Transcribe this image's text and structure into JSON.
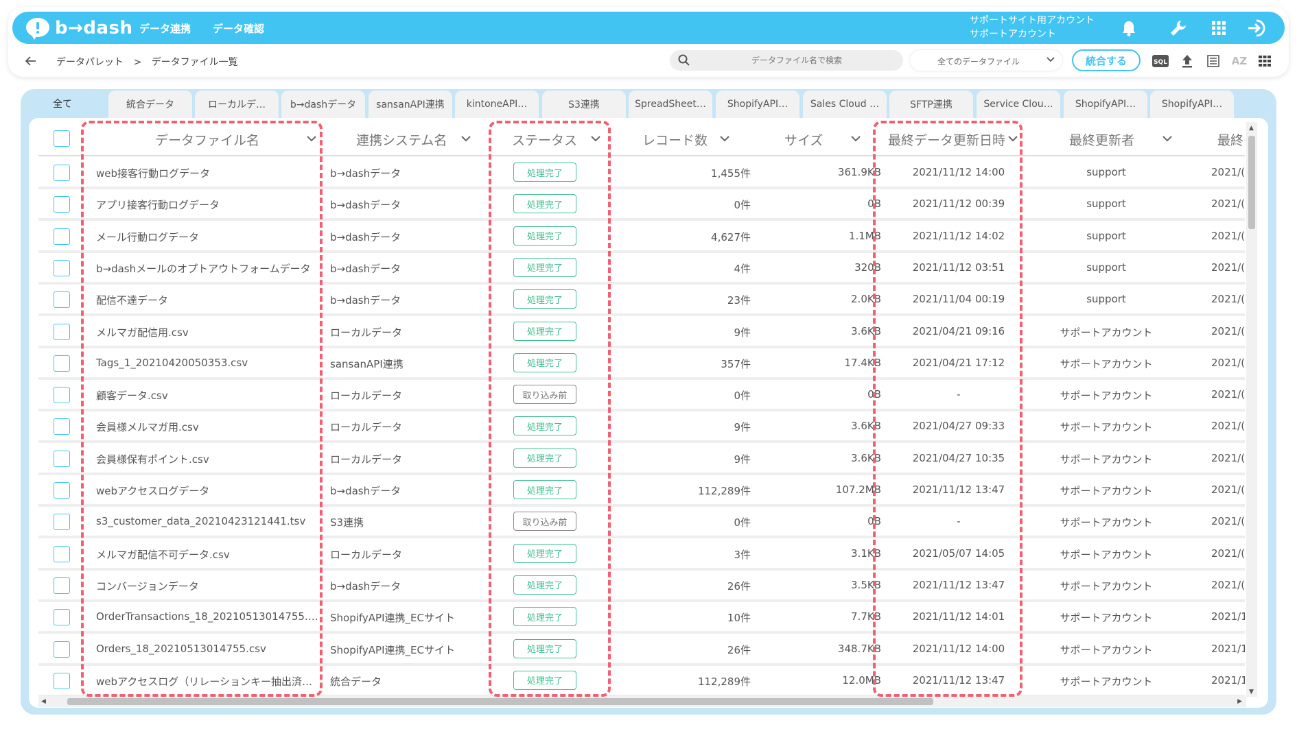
{
  "app": {
    "logo_text": "b→dash",
    "nav": [
      "データ連携",
      "データ確認"
    ],
    "account_line1": "サポートサイト用アカウント",
    "account_line2": "サポートアカウント"
  },
  "breadcrumb": {
    "parent": "データパレット",
    "separator": ">",
    "current": "データファイル一覧"
  },
  "search": {
    "placeholder": "データファイル名で検索"
  },
  "file_filter": {
    "selected": "全てのデータファイル"
  },
  "merge_button": "統合する",
  "toolbar": {
    "sql": "SQL",
    "az": "AZ"
  },
  "tabs": [
    "全て",
    "統合データ",
    "ローカルデ…",
    "b→dashデータ",
    "sansanAPI連携",
    "kintoneAPI…",
    "S3連携",
    "SpreadSheet…",
    "ShopifyAPI…",
    "Sales Cloud …",
    "SFTP連携",
    "Service Clou…",
    "ShopifyAPI…",
    "ShopifyAPI…"
  ],
  "table": {
    "columns": [
      "データファイル名",
      "連携システム名",
      "ステータス",
      "レコード数",
      "サイズ",
      "最終データ更新日時",
      "最終更新者",
      "最終"
    ],
    "rows": [
      {
        "name": "web接客行動ログデータ",
        "system": "b→dashデータ",
        "status": "処理完了",
        "records": "1,455件",
        "size": "361.9KB",
        "updated": "2021/11/12 14:00",
        "user": "support",
        "last": "2021/("
      },
      {
        "name": "アプリ接客行動ログデータ",
        "system": "b→dashデータ",
        "status": "処理完了",
        "records": "0件",
        "size": "0B",
        "updated": "2021/11/12 00:39",
        "user": "support",
        "last": "2021/("
      },
      {
        "name": "メール行動ログデータ",
        "system": "b→dashデータ",
        "status": "処理完了",
        "records": "4,627件",
        "size": "1.1MB",
        "updated": "2021/11/12 14:02",
        "user": "support",
        "last": "2021/("
      },
      {
        "name": "b→dashメールのオプトアウトフォームデータ",
        "system": "b→dashデータ",
        "status": "処理完了",
        "records": "4件",
        "size": "320B",
        "updated": "2021/11/12 03:51",
        "user": "support",
        "last": "2021/("
      },
      {
        "name": "配信不達データ",
        "system": "b→dashデータ",
        "status": "処理完了",
        "records": "23件",
        "size": "2.0KB",
        "updated": "2021/11/04 00:19",
        "user": "support",
        "last": "2021/("
      },
      {
        "name": "メルマガ配信用.csv",
        "system": "ローカルデータ",
        "status": "処理完了",
        "records": "9件",
        "size": "3.6KB",
        "updated": "2021/04/21 09:16",
        "user": "サポートアカウント",
        "last": "2021/("
      },
      {
        "name": "Tags_1_20210420050353.csv",
        "system": "sansanAPI連携",
        "status": "処理完了",
        "records": "357件",
        "size": "17.4KB",
        "updated": "2021/04/21 17:12",
        "user": "サポートアカウント",
        "last": "2021/("
      },
      {
        "name": "顧客データ.csv",
        "system": "ローカルデータ",
        "status": "取り込み前",
        "records": "0件",
        "size": "0B",
        "updated": "-",
        "user": "サポートアカウント",
        "last": "2021/("
      },
      {
        "name": "会員様メルマガ用.csv",
        "system": "ローカルデータ",
        "status": "処理完了",
        "records": "9件",
        "size": "3.6KB",
        "updated": "2021/04/27 09:33",
        "user": "サポートアカウント",
        "last": "2021/("
      },
      {
        "name": "会員様保有ポイント.csv",
        "system": "ローカルデータ",
        "status": "処理完了",
        "records": "9件",
        "size": "3.6KB",
        "updated": "2021/04/27 10:35",
        "user": "サポートアカウント",
        "last": "2021/("
      },
      {
        "name": "webアクセスログデータ",
        "system": "b→dashデータ",
        "status": "処理完了",
        "records": "112,289件",
        "size": "107.2MB",
        "updated": "2021/11/12 13:47",
        "user": "サポートアカウント",
        "last": "2021/("
      },
      {
        "name": "s3_customer_data_20210423121441.tsv",
        "system": "S3連携",
        "status": "取り込み前",
        "records": "0件",
        "size": "0B",
        "updated": "-",
        "user": "サポートアカウント",
        "last": "2021/("
      },
      {
        "name": "メルマガ配信不可データ.csv",
        "system": "ローカルデータ",
        "status": "処理完了",
        "records": "3件",
        "size": "3.1KB",
        "updated": "2021/05/07 14:05",
        "user": "サポートアカウント",
        "last": "2021/("
      },
      {
        "name": "コンバージョンデータ",
        "system": "b→dashデータ",
        "status": "処理完了",
        "records": "26件",
        "size": "3.5KB",
        "updated": "2021/11/12 13:47",
        "user": "サポートアカウント",
        "last": "2021/("
      },
      {
        "name": "OrderTransactions_18_20210513014755.…",
        "system": "ShopifyAPI連携_ECサイト",
        "status": "処理完了",
        "records": "10件",
        "size": "7.7KB",
        "updated": "2021/11/12 14:01",
        "user": "サポートアカウント",
        "last": "2021/1"
      },
      {
        "name": "Orders_18_20210513014755.csv",
        "system": "ShopifyAPI連携_ECサイト",
        "status": "処理完了",
        "records": "26件",
        "size": "348.7KB",
        "updated": "2021/11/12 14:00",
        "user": "サポートアカウント",
        "last": "2021/1"
      },
      {
        "name": "webアクセスログ（リレーションキー抽出済…",
        "system": "統合データ",
        "status": "処理完了",
        "records": "112,289件",
        "size": "12.0MB",
        "updated": "2021/11/12 13:47",
        "user": "サポートアカウント",
        "last": "2021/1"
      }
    ]
  },
  "colors": {
    "brand": "#41c4f2",
    "status_done": "#3fbf8f",
    "highlight": "#f06072",
    "tab_area": "#c6e6f7"
  }
}
